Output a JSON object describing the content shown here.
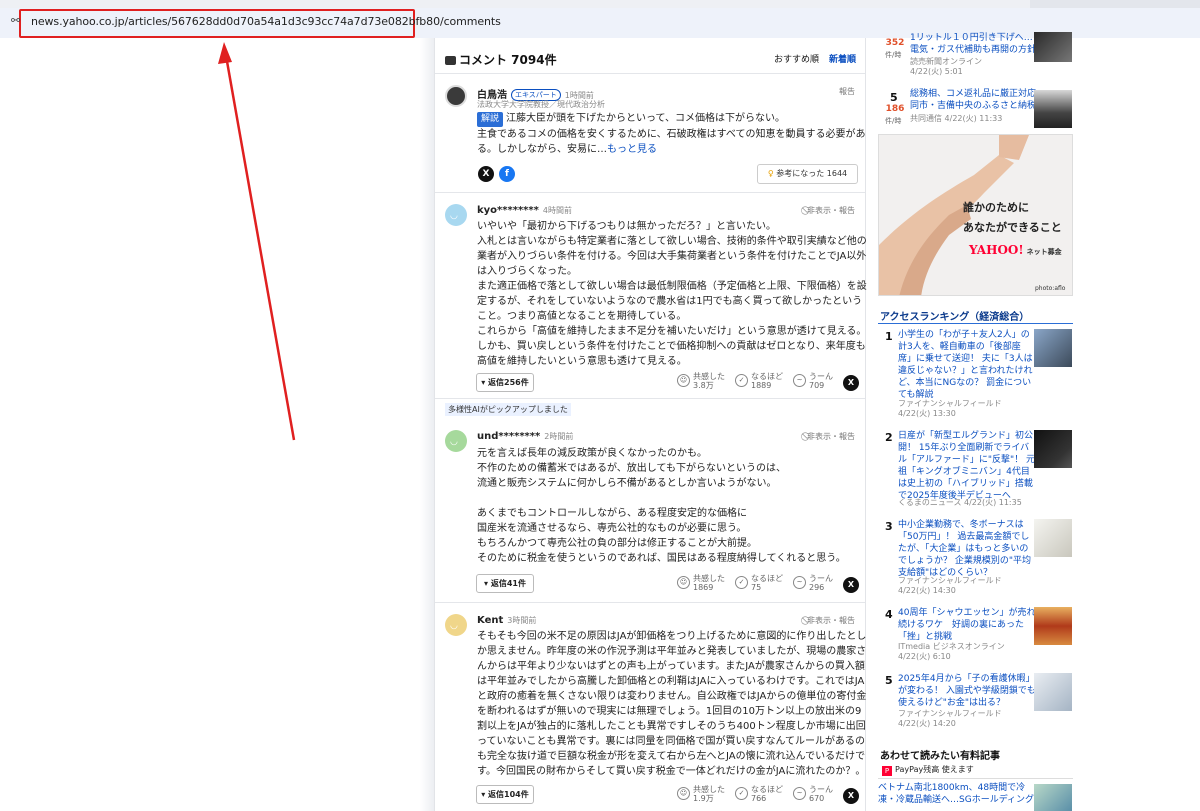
{
  "browser": {
    "url": "news.yahoo.co.jp/articles/567628dd0d70a54a1d3c93cc74a7d73e082bfb80/comments"
  },
  "comments": {
    "heading": "コメント 7094件",
    "sort_recommended": "おすすめ順",
    "sort_newest": "新着順",
    "pickup_label": "多様性AIがピックアップしました",
    "items": [
      {
        "user": "白鳥浩",
        "expert_badge": "エキスパート",
        "time": "1時間前",
        "affiliation": "法政大学大学院教授／現代政治分析",
        "report": "報告",
        "tag": "解説",
        "lines": [
          "江藤大臣が頭を下げたからといって、コメ価格は下がらない。",
          "主食であるコメの価格を安くするために、石破政権はすべての知恵を動員する必要があ",
          "る。しかしながら、安易に…"
        ],
        "more": "もっと見る",
        "helpful": "参考になった 1644"
      },
      {
        "user": "kyo********",
        "time": "4時間前",
        "report": "非表示・報告",
        "lines": [
          "いやいや「最初から下げるつもりは無かっただろ？」と言いたい。",
          "入札とは言いながらも特定業者に落として欲しい場合、技術的条件や取引実績など他の",
          "業者が入りづらい条件を付ける。今回は大手集荷業者という条件を付けたことでJA以外",
          "は入りづらくなった。",
          "また適正価格で落として欲しい場合は最低制限価格（予定価格と上限、下限価格）を設",
          "定するが、それをしていないようなので農水省は1円でも高く買って欲しかったという",
          "こと。つまり高値となることを期待している。",
          "これらから「高値を維持したまま不足分を補いたいだけ」という意思が透けて見える。",
          "しかも、買い戻しという条件を付けたことで価格抑制への貢献はゼロとなり、来年度も",
          "高値を維持したいという意思も透けて見える。"
        ],
        "reply": "返信256件",
        "react1_label": "共感した",
        "react1_count": "3.8万",
        "react2_label": "なるほど",
        "react2_count": "1889",
        "react3_label": "うーん",
        "react3_count": "709"
      },
      {
        "user": "und********",
        "time": "2時間前",
        "report": "非表示・報告",
        "lines": [
          "元を言えば長年の減反政策が良くなかったのかも。",
          "不作のための備蓄米ではあるが、放出しても下がらないというのは、",
          "流通と販売システムに何かしら不備があるとしか言いようがない。",
          "",
          "あくまでもコントロールしながら、ある程度安定的な価格に",
          "国産米を流通させるなら、専売公社的なものが必要に思う。",
          "もちろんかつて専売公社の負の部分は修正することが大前提。",
          "そのために税金を使うというのであれば、国民はある程度納得してくれると思う。"
        ],
        "reply": "返信41件",
        "react1_label": "共感した",
        "react1_count": "1869",
        "react2_label": "なるほど",
        "react2_count": "75",
        "react3_label": "うーん",
        "react3_count": "296"
      },
      {
        "user": "Kent",
        "time": "3時間前",
        "report": "非表示・報告",
        "lines": [
          "そもそも今回の米不足の原因はJAが卸価格をつり上げるために意図的に作り出したとし",
          "か思えません。昨年度の米の作況予測は平年並みと発表していましたが、現場の農家さ",
          "んからは平年より少ないはずとの声も上がっています。またJAが農家さんからの買入額",
          "は平年並みでしたから高騰した卸価格との利鞘はJAに入っているわけです。これではJA",
          "と政府の癒着を無くさない限りは変わりません。自公政権ではJAからの億単位の寄付金",
          "を断われるはずが無いので現実には無理でしょう。1回目の10万トン以上の放出米の9",
          "割以上をJAが独占的に落札したことも異常ですしそのうち400トン程度しか市場に出回",
          "っていないことも異常です。裏には同量を同価格で国が買い戻すなんてルールがあるの",
          "も完全な抜け道で巨額な税金が形を変えて右から左へとJAの懐に流れ込んでいるだけで",
          "す。今回国民の財布からそして買い戻す税金で一体どれだけの金がJAに流れたのか？。"
        ],
        "reply": "返信104件",
        "react1_label": "共感した",
        "react1_count": "1.9万",
        "react2_label": "なるほど",
        "react2_count": "766",
        "react3_label": "うーん",
        "react3_count": "670"
      }
    ]
  },
  "sidebar": {
    "top_rank": [
      {
        "count": "352",
        "unit": "件/時",
        "title_lines": [
          "1リットル１０円引き下げへ…",
          "電気・ガス代補助も再開の方針"
        ],
        "source": "読売新聞オンライン",
        "date": "4/22(火) 5:01"
      },
      {
        "rank": "5",
        "count": "186",
        "unit": "件/時",
        "title_lines": [
          "総務相、コメ返礼品に厳正対応",
          "同市・吉備中央のふるさと納税"
        ],
        "source": "共同通信 4/22(火) 11:33"
      }
    ],
    "ad": {
      "line1": "誰かのために",
      "line2": "あなたができること",
      "logo": "YAHOO!",
      "logo_sub": "ネット募金",
      "credit": "photo:aflo"
    },
    "access_ranking_title": "アクセスランキング（経済総合）",
    "access_ranking": [
      {
        "rank": "1",
        "title_lines": [
          "小学生の「わが子＋友人2人」の",
          "計3人を、軽自動車の「後部座",
          "席」に乗せて送迎！ 夫に「3人は",
          "違反じゃない？」と言われたけれ",
          "ど、本当にNGなの？ 罰金につい",
          "ても解説"
        ],
        "source": "ファイナンシャルフィールド",
        "date": "4/22(火) 13:30"
      },
      {
        "rank": "2",
        "title_lines": [
          "日産が「新型エルグランド」初公",
          "開！ 15年ぶり全面刷新でライバ",
          "ル「アルファード」に\"反撃\"！ 元",
          "祖「キングオブミニバン」4代目",
          "は史上初の「ハイブリッド」搭載",
          "で2025年度後半デビューへ"
        ],
        "source": "くるまのニュース 4/22(火) 11:35"
      },
      {
        "rank": "3",
        "title_lines": [
          "中小企業勤務で、冬ボーナスは",
          "「50万円」！ 過去最高金額でし",
          "たが、「大企業」はもっと多いの",
          "でしょうか？ 企業規模別の\"平均",
          "支給額\"はどのくらい？"
        ],
        "source": "ファイナンシャルフィールド",
        "date": "4/22(火) 14:30"
      },
      {
        "rank": "4",
        "title_lines": [
          "40周年「シャウエッセン」が売れ",
          "続けるワケ　好調の裏にあった",
          "「挫」と挑戦"
        ],
        "source": "ITmedia ビジネスオンライン",
        "date": "4/22(火) 6:10"
      },
      {
        "rank": "5",
        "title_lines": [
          "2025年4月から「子の看護休暇」",
          "が変わる！ 入園式や学級閉鎖でも",
          "使えるけど\"お金\"は出る？"
        ],
        "source": "ファイナンシャルフィールド",
        "date": "4/22(火) 14:20"
      }
    ],
    "paid_title": "あわせて読みたい有料記事",
    "paypay": "PayPay残高 使えます",
    "paid_item_lines": [
      "ベトナム南北1800km、48時間で冷",
      "凍・冷蔵品輸送へ…SGホールディング"
    ]
  }
}
